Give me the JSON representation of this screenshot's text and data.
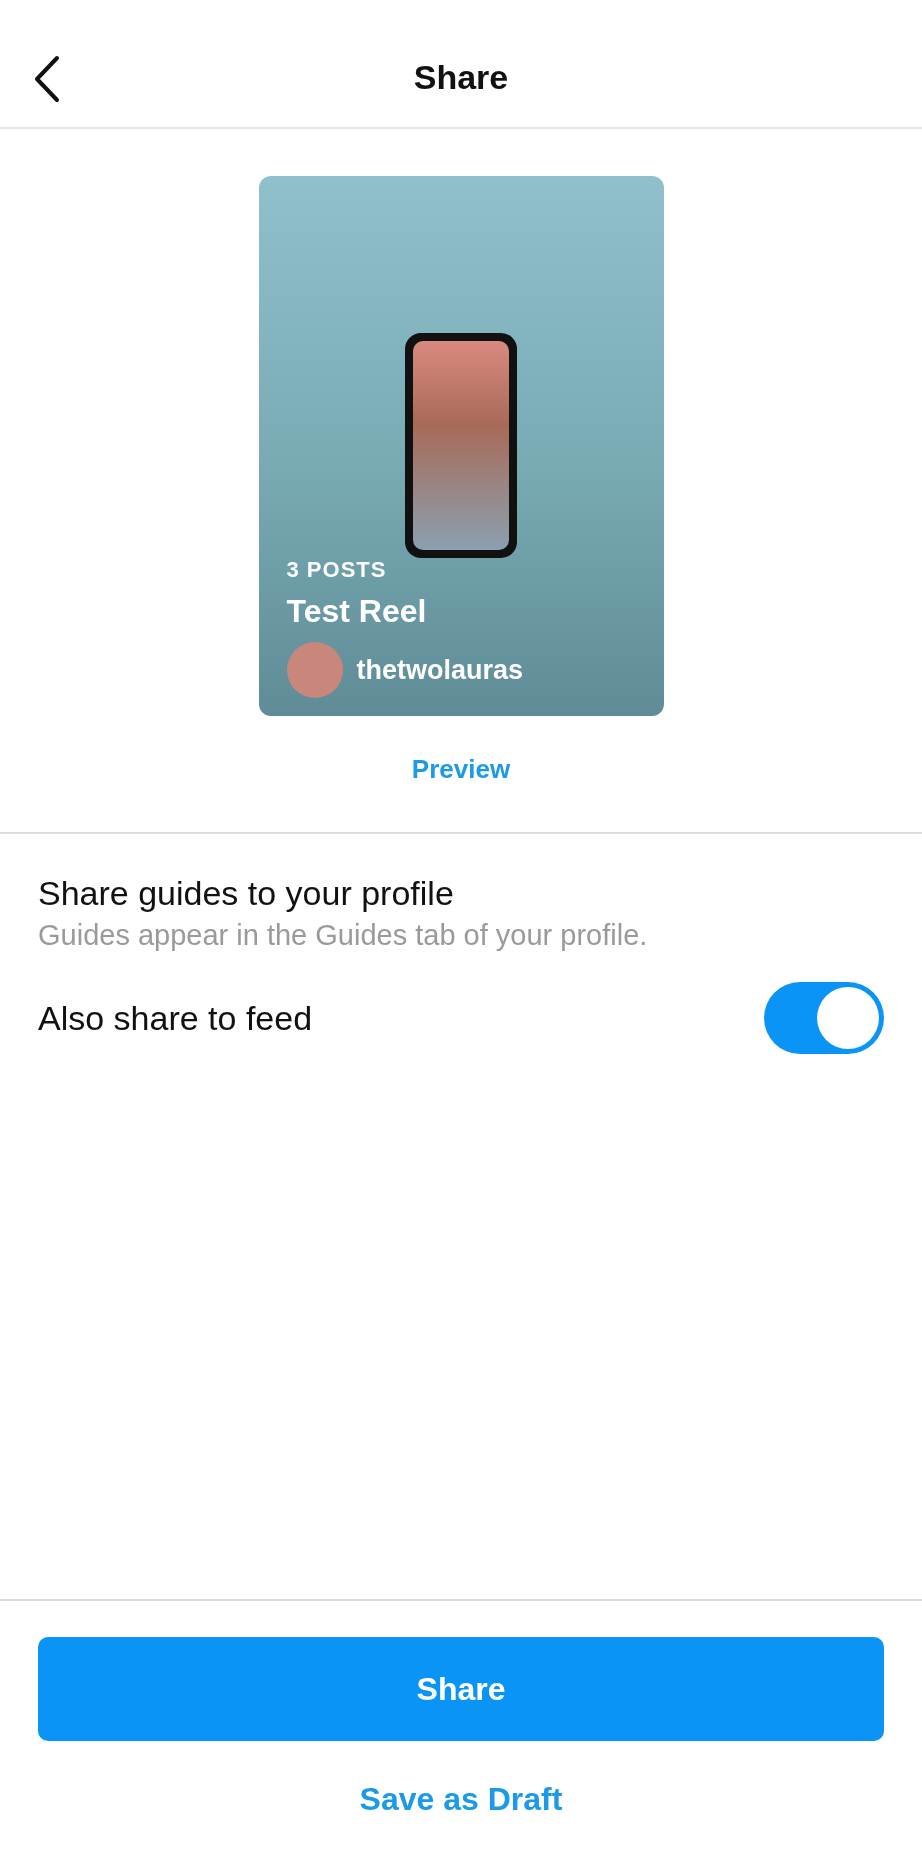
{
  "header": {
    "title": "Share"
  },
  "guide_cover": {
    "post_count": "3 POSTS",
    "title": "Test Reel",
    "username": "thetwolauras"
  },
  "preview_link": "Preview",
  "settings": [
    {
      "kind": "info",
      "label": "Share guides to your profile",
      "description": "Guides appear in the Guides tab of your profile."
    },
    {
      "kind": "toggle",
      "label": "Also share to feed",
      "on": true
    }
  ],
  "share_button": "Share",
  "draft_link": "Save as Draft"
}
